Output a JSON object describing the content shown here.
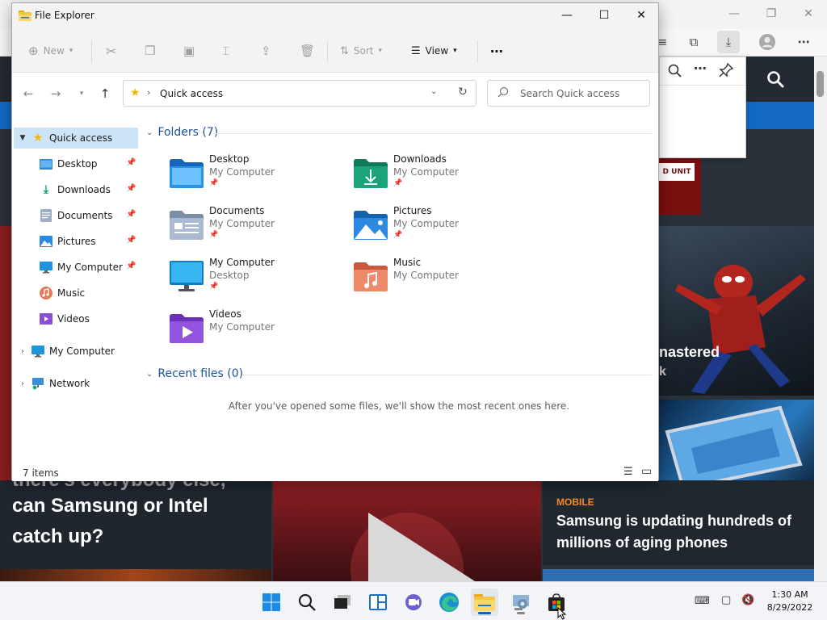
{
  "background_browser": {
    "card_left_text_1": "can Samsung or Intel",
    "card_left_text_2": "catch up?",
    "card_left_partial": "there's everybody else,",
    "card_right_category": "MOBILE",
    "card_right_text_1": "Samsung is updating hundreds of",
    "card_right_text_2": "millions of aging phones",
    "card_mid_text": "nastered",
    "card_mid_text_2": "k",
    "banner_button": "D UNIT"
  },
  "explorer": {
    "title": "File Explorer",
    "commands": {
      "new": "New",
      "sort": "Sort",
      "view": "View"
    },
    "address": {
      "location": "Quick access",
      "search_placeholder": "Search Quick access"
    },
    "nav": {
      "quick_access": "Quick access",
      "items": [
        {
          "label": "Desktop",
          "pinned": true
        },
        {
          "label": "Downloads",
          "pinned": true
        },
        {
          "label": "Documents",
          "pinned": true
        },
        {
          "label": "Pictures",
          "pinned": true
        },
        {
          "label": "My Computer",
          "pinned": true
        },
        {
          "label": "Music",
          "pinned": false
        },
        {
          "label": "Videos",
          "pinned": false
        }
      ],
      "my_computer": "My Computer",
      "network": "Network"
    },
    "content": {
      "folders_header": "Folders (7)",
      "folders": [
        {
          "name": "Desktop",
          "location": "My Computer",
          "pinned": true
        },
        {
          "name": "Downloads",
          "location": "My Computer",
          "pinned": true
        },
        {
          "name": "Documents",
          "location": "My Computer",
          "pinned": true
        },
        {
          "name": "Pictures",
          "location": "My Computer",
          "pinned": true
        },
        {
          "name": "My Computer",
          "location": "Desktop",
          "pinned": true
        },
        {
          "name": "Music",
          "location": "My Computer",
          "pinned": false
        },
        {
          "name": "Videos",
          "location": "My Computer",
          "pinned": false
        }
      ],
      "recent_header": "Recent files (0)",
      "recent_empty": "After you've opened some files, we'll show the most recent ones here."
    },
    "status": {
      "items": "7 items"
    }
  },
  "taskbar": {
    "time": "1:30 AM",
    "date": "8/29/2022"
  }
}
